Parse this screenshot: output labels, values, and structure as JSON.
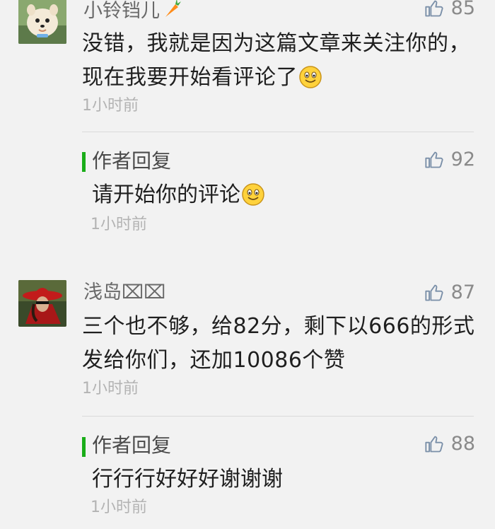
{
  "comments": [
    {
      "name": "小铃铛儿",
      "name_emoji": "carrot",
      "likes": "85",
      "text": "没错，我就是因为这篇文章来关注你的，现在我要开始看评论了",
      "text_emoji": "smile-emoji",
      "time": "1小时前",
      "reply": {
        "label": "作者回复",
        "likes": "92",
        "text": "请开始你的评论",
        "text_emoji": "smile-emoji",
        "time": "1小时前"
      }
    },
    {
      "name": "浅岛⌧⌧",
      "likes": "87",
      "text": "三个也不够，给82分，剩下以666的形式发给你们，还加10086个赞",
      "time": "1小时前",
      "reply": {
        "label": "作者回复",
        "likes": "88",
        "text": "行行行好好好谢谢谢",
        "time": "1小时前"
      }
    }
  ],
  "colors": {
    "background": "#f2f2f2",
    "reply_bar": "#1aad19",
    "meta": "#b3b3b3"
  }
}
